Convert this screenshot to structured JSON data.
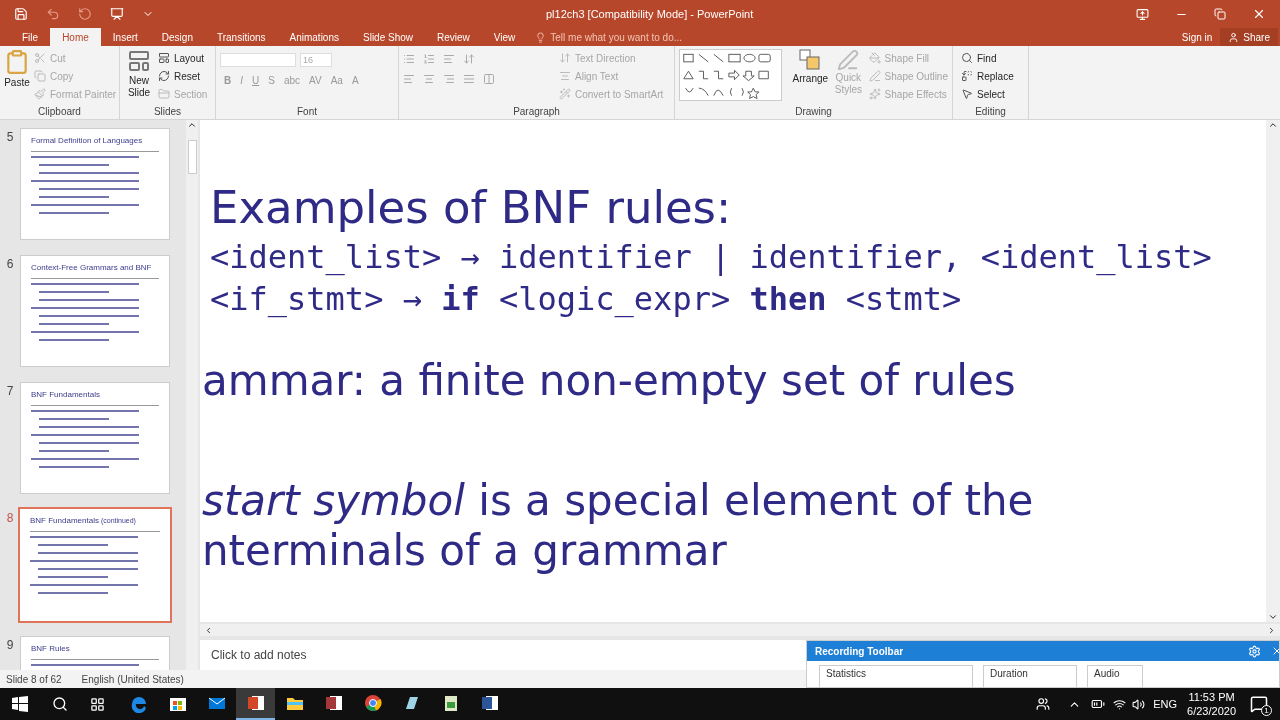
{
  "window": {
    "title": "pl12ch3 [Compatibility Mode] - PowerPoint"
  },
  "tabs": [
    {
      "label": "File",
      "selected": false
    },
    {
      "label": "Home",
      "selected": true
    },
    {
      "label": "Insert",
      "selected": false
    },
    {
      "label": "Design",
      "selected": false
    },
    {
      "label": "Transitions",
      "selected": false
    },
    {
      "label": "Animations",
      "selected": false
    },
    {
      "label": "Slide Show",
      "selected": false
    },
    {
      "label": "Review",
      "selected": false
    },
    {
      "label": "View",
      "selected": false
    }
  ],
  "tell_me": {
    "placeholder": "Tell me what you want to do..."
  },
  "account": {
    "sign_in": "Sign in",
    "share": "Share"
  },
  "clipboard": {
    "label": "Clipboard",
    "paste": "Paste",
    "items": [
      {
        "label": "Cut",
        "disabled": true
      },
      {
        "label": "Copy",
        "disabled": true
      },
      {
        "label": "Format Painter",
        "disabled": true
      }
    ]
  },
  "slides_group": {
    "label": "Slides",
    "new_slide": "New Slide",
    "items": [
      {
        "label": "Layout",
        "disabled": false
      },
      {
        "label": "Reset",
        "disabled": false
      },
      {
        "label": "Section",
        "disabled": true
      }
    ]
  },
  "font": {
    "label": "Font",
    "size": "16",
    "buttons": [
      "B",
      "I",
      "U",
      "S",
      "abc",
      "AV",
      "Aa",
      "A"
    ]
  },
  "paragraph": {
    "label": "Paragraph",
    "items": [
      {
        "label": "Text Direction",
        "disabled": true
      },
      {
        "label": "Align Text",
        "disabled": true
      },
      {
        "label": "Convert to SmartArt",
        "disabled": true
      }
    ]
  },
  "drawing": {
    "label": "Drawing",
    "arrange": "Arrange",
    "quick_styles": {
      "label": "Quick Styles",
      "disabled": true
    },
    "items": [
      {
        "label": "Shape Fill",
        "disabled": true
      },
      {
        "label": "Shape Outline",
        "disabled": true
      },
      {
        "label": "Shape Effects",
        "disabled": true
      }
    ]
  },
  "editing": {
    "label": "Editing",
    "items": [
      {
        "kind": "find",
        "label": "Find"
      },
      {
        "kind": "replace",
        "label": "Replace"
      },
      {
        "kind": "select",
        "label": "Select"
      }
    ]
  },
  "thumbnails": [
    {
      "number": "5",
      "title": "Formal Definition of Languages",
      "selected": false
    },
    {
      "number": "6",
      "title": "Context-Free Grammars and BNF",
      "selected": false
    },
    {
      "number": "7",
      "title": "BNF Fundamentals",
      "selected": false
    },
    {
      "number": "8",
      "title": "BNF Fundamentals",
      "note": "(continued)",
      "selected": true
    },
    {
      "number": "9",
      "title": "BNF Rules",
      "selected": false
    }
  ],
  "slide": {
    "heading": "Examples of BNF rules:",
    "rules": [
      "<ident_list> → identifier | identifier, <ident_list>",
      "<if_stmt> → **if** <logic_expr> **then** <stmt>"
    ],
    "lines": [
      "ammar: a finite non-empty set of rules",
      "*start symbol* is a special element of the nterminals of a grammar"
    ]
  },
  "notes": {
    "placeholder": "Click to add notes"
  },
  "recording_toolbar": {
    "title": "Recording Toolbar",
    "sections": [
      "Statistics",
      "Duration",
      "Audio"
    ]
  },
  "status_bar": {
    "slide": "Slide 8 of 62",
    "language": "English (United States)"
  },
  "taskbar": {
    "apps": [
      {
        "kind": "edge",
        "selected": false
      },
      {
        "kind": "store",
        "selected": false
      },
      {
        "kind": "mail",
        "selected": false
      },
      {
        "kind": "powerpoint",
        "selected": true
      },
      {
        "kind": "explorer",
        "selected": false
      },
      {
        "kind": "access",
        "selected": false
      },
      {
        "kind": "chrome",
        "selected": false
      },
      {
        "kind": "notes",
        "selected": false
      },
      {
        "kind": "sheet",
        "selected": false
      },
      {
        "kind": "word",
        "selected": false
      }
    ],
    "language": "ENG",
    "time": "11:53 PM",
    "date": "6/23/2020",
    "notifications": "1"
  }
}
